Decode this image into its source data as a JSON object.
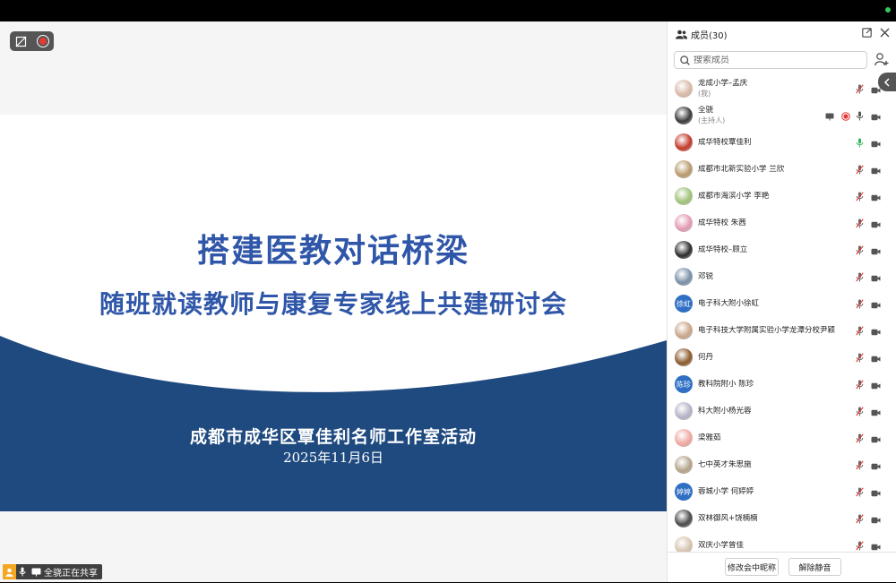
{
  "slide": {
    "title_main": "搭建医教对话桥梁",
    "title_sub": "随班就读教师与康复专家线上共建研讨会",
    "organizer": "成都市成华区覃佳利名师工作室活动",
    "date": "2025年11月6日",
    "colors": {
      "title": "#2f56a8",
      "band": "#1f4a7f"
    }
  },
  "share_status": {
    "text": "全骁正在共享"
  },
  "panel": {
    "title": "成员(30)",
    "search_placeholder": "搜索成员",
    "buttons": {
      "rename": "修改会中昵称",
      "unmute_all": "解除静音"
    }
  },
  "members": [
    {
      "name": "龙成小学–孟庆",
      "sub": "(我)",
      "avatar": "photo",
      "color": "#d9b9a8",
      "mic": "muted",
      "cam": "on"
    },
    {
      "name": "全骁",
      "sub": "(主持人)",
      "avatar": "photo",
      "color": "#3a3a3a",
      "mic": "on",
      "cam": "on",
      "sharing": true,
      "recording": true
    },
    {
      "name": "成华特校覃佳利",
      "avatar": "photo",
      "color": "#c23a2a",
      "mic": "speaking",
      "cam": "on"
    },
    {
      "name": "成都市北新实验小学  兰欣",
      "avatar": "photo",
      "color": "#b99a6d",
      "mic": "muted",
      "cam": "on"
    },
    {
      "name": "成都市海滨小学 李艳",
      "avatar": "photo",
      "color": "#9fc27a",
      "mic": "muted",
      "cam": "on"
    },
    {
      "name": "成华特校 朱茜",
      "avatar": "photo",
      "color": "#e29bb4",
      "mic": "muted",
      "cam": "on"
    },
    {
      "name": "成华特校–顾立",
      "avatar": "photo",
      "color": "#2b2b2b",
      "mic": "muted",
      "cam": "on"
    },
    {
      "name": "邓锐",
      "avatar": "photo",
      "color": "#7a8fa8",
      "mic": "muted",
      "cam": "on"
    },
    {
      "name": "电子科大附小徐虹",
      "avatar": "text",
      "initials": "徐虹",
      "color": "#2f6fc4",
      "mic": "muted",
      "cam": "on"
    },
    {
      "name": "电子科技大学附属实验小学龙潭分校尹颖",
      "avatar": "photo",
      "color": "#c9a58a",
      "mic": "muted",
      "cam": "on"
    },
    {
      "name": "何丹",
      "avatar": "photo",
      "color": "#8a5a2b",
      "mic": "muted",
      "cam": "on"
    },
    {
      "name": "教科院附小 陈珍",
      "avatar": "text",
      "initials": "陈珍",
      "color": "#2f6fc4",
      "mic": "muted",
      "cam": "on"
    },
    {
      "name": "科大附小杨光蓉",
      "avatar": "photo",
      "color": "#b7b2c8",
      "mic": "muted",
      "cam": "on"
    },
    {
      "name": "梁雅茹",
      "avatar": "photo",
      "color": "#f0a8a0",
      "mic": "muted",
      "cam": "on"
    },
    {
      "name": "七中英才朱思施",
      "avatar": "photo",
      "color": "#b5a48c",
      "mic": "muted",
      "cam": "on"
    },
    {
      "name": "蓉城小学 何婷婷",
      "avatar": "text",
      "initials": "婷婷",
      "color": "#2f6fc4",
      "mic": "muted",
      "cam": "on"
    },
    {
      "name": "双林御风+饶楠楠",
      "avatar": "photo",
      "color": "#4a4a4a",
      "mic": "muted",
      "cam": "on"
    },
    {
      "name": "双庆小学曾佳",
      "avatar": "photo",
      "color": "#d8c4b0",
      "mic": "muted",
      "cam": "on"
    }
  ],
  "icons": {
    "members": "people-icon",
    "popout": "popout-icon",
    "close": "close-icon",
    "search": "search-icon",
    "invite": "add-user-icon",
    "collapse": "chevron-left-icon"
  }
}
